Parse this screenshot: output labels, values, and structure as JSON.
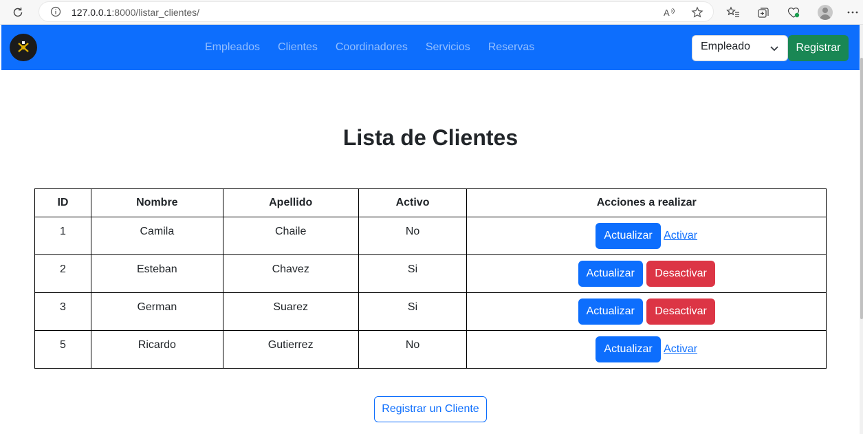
{
  "browser": {
    "url_host": "127.0.0.1",
    "url_rest": ":8000/listar_clientes/",
    "reader_icon_label": "Aᵃ⁾"
  },
  "navbar": {
    "links": [
      "Empleados",
      "Clientes",
      "Coordinadores",
      "Servicios",
      "Reservas"
    ],
    "role_selected": "Empleado",
    "register_label": "Registrar"
  },
  "main": {
    "title": "Lista de Clientes",
    "table": {
      "headers": [
        "ID",
        "Nombre",
        "Apellido",
        "Activo",
        "Acciones a realizar"
      ],
      "rows": [
        {
          "id": "1",
          "nombre": "Camila",
          "apellido": "Chaile",
          "activo": "No",
          "action_primary": "Actualizar",
          "action_secondary": "Activar"
        },
        {
          "id": "2",
          "nombre": "Esteban",
          "apellido": "Chavez",
          "activo": "Si",
          "action_primary": "Actualizar",
          "action_secondary": "Desactivar"
        },
        {
          "id": "3",
          "nombre": "German",
          "apellido": "Suarez",
          "activo": "Si",
          "action_primary": "Actualizar",
          "action_secondary": "Desactivar"
        },
        {
          "id": "5",
          "nombre": "Ricardo",
          "apellido": "Gutierrez",
          "activo": "No",
          "action_primary": "Actualizar",
          "action_secondary": "Activar"
        }
      ]
    },
    "add_button_label": "Registrar un Cliente"
  },
  "colors": {
    "primary": "#0d6efd",
    "success": "#198754",
    "danger": "#dc3545"
  }
}
